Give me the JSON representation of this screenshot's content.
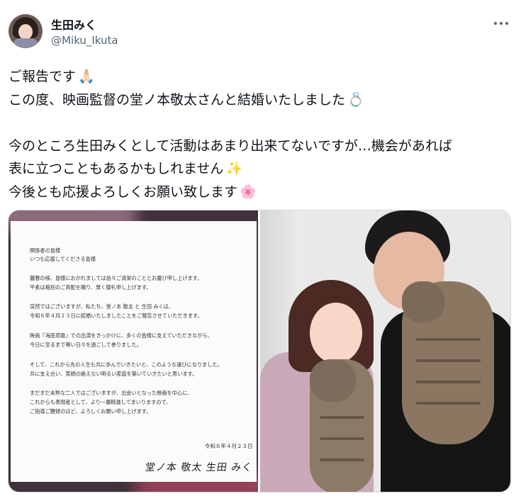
{
  "author": {
    "name": "生田みく",
    "handle": "@Miku_Ikuta"
  },
  "tweet": {
    "lines": [
      {
        "text": "ご報告です",
        "emoji": "🙏🏻"
      },
      {
        "text": "この度、映画監督の堂ノ本敬太さんと結婚いたしました",
        "emoji": "💍"
      },
      {
        "text": "",
        "emoji": ""
      },
      {
        "text": "今のところ生田みくとして活動はあまり出来てないですが…機会があれば",
        "emoji": ""
      },
      {
        "text": "表に立つこともあるかもしれません",
        "emoji": "✨"
      },
      {
        "text": "今後とも応援よろしくお願い致します",
        "emoji": "🌸"
      }
    ]
  },
  "more_icon": "more-horizontal-icon",
  "letter": {
    "lines": [
      "関係者の皆様",
      "いつも応援してくださる皆様",
      "",
      "麗春の候、皆様におかれましては益々ご清栄のこととお慶び申し上げます。",
      "平素は格別のご高配を賜り、厚く御礼申し上げます。",
      "",
      "突然ではございますが、私たち、堂ノ本 敬太 と 生田 みくは、",
      "令和６年４月２３日に結婚いたしましたことをご報告させていただきます。",
      "",
      "映画『海底悲歌』での出演をきっかけに、多くの皆様に支えていただきながら、",
      "今日に至るまで尊い日々を過ごして参りました。",
      "",
      "そして、これから先の人生も共に歩んでいきたいと、このような運びになりました。",
      "共に支え合い、笑顔の絶えない明るい家庭を築いていきたいと思います。",
      "",
      "まだまだ未熟な二人ではございますが、出会いとなった映画を中心に、",
      "これからも表現者として、より一層精進してまいりますので、",
      "ご指導ご鞭撻のほど、よろしくお願い申し上げます。"
    ],
    "date": "令和６年４月２３日",
    "signature": "堂ノ本 敬太  生田 みく"
  }
}
